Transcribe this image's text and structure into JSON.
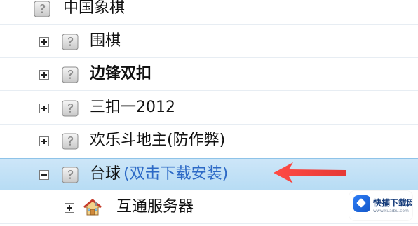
{
  "tree": {
    "items": [
      {
        "label": "中国象棋",
        "bold": false,
        "expander": null
      },
      {
        "label": "围棋",
        "bold": false,
        "expander": "plus"
      },
      {
        "label": "边锋双扣",
        "bold": true,
        "expander": "plus"
      },
      {
        "label": "三扣一2012",
        "bold": false,
        "expander": "plus"
      },
      {
        "label": "欢乐斗地主(防作弊)",
        "bold": false,
        "expander": "plus"
      },
      {
        "label": "台球",
        "hint": "(双击下载安装)",
        "bold": false,
        "expander": "minus",
        "selected": true
      },
      {
        "label": "互通服务器",
        "bold": false,
        "expander": "plus",
        "icon": "house-icon"
      }
    ]
  },
  "watermark": {
    "text": "快捕下载网",
    "sub": "www.kuaibu.com"
  },
  "icons": {
    "question_icon": "question-mark-icon",
    "house_icon": "house-icon",
    "arrow_icon": "red-arrow-icon"
  },
  "colors": {
    "selection_bg": "#b7dcf4",
    "hint_text": "#2c69c6",
    "arrow": "#e53935"
  }
}
